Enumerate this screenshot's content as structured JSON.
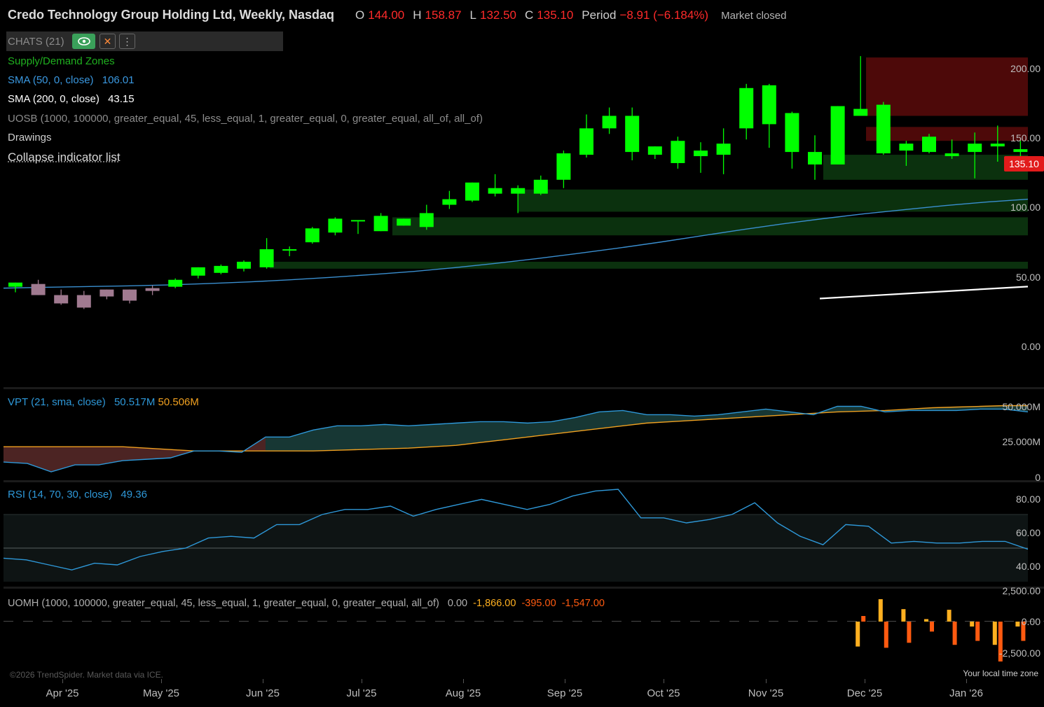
{
  "header": {
    "title": "Credo Technology Group Holding Ltd, Weekly, Nasdaq",
    "o_label": "O",
    "o": "144.00",
    "h_label": "H",
    "h": "158.87",
    "l_label": "L",
    "l": "132.50",
    "c_label": "C",
    "c": "135.10",
    "period_label": "Period",
    "period": "−8.91 (−6.184%)",
    "market_status": "Market closed"
  },
  "indicators": {
    "chats": "CHATS (21)",
    "supply_demand": "Supply/Demand Zones",
    "sma50_label": "SMA (50, 0, close)",
    "sma50_value": "106.01",
    "sma200_label": "SMA (200, 0, close)",
    "sma200_value": "43.15",
    "uosb": "UOSB (1000, 100000, greater_equal, 45, less_equal, 1, greater_equal, 0, greater_equal, all_of, all_of)",
    "drawings": "Drawings",
    "collapse": "Collapse indicator list",
    "vpt_label": "VPT (21, sma, close)",
    "vpt_value1": "50.517M",
    "vpt_value2": "50.506M",
    "rsi_label": "RSI (14, 70, 30, close)",
    "rsi_value": "49.36",
    "uomh_label": "UOMH (1000, 100000, greater_equal, 45, less_equal, 1, greater_equal, 0, greater_equal, all_of)",
    "uomh_v1": "0.00",
    "uomh_v2": "-1,866.00",
    "uomh_v3": "-395.00",
    "uomh_v4": "-1,547.00"
  },
  "price_tag": "135.10",
  "footer": {
    "copyright": "©2026 TrendSpider. Market data via ICE.",
    "timezone": "Your local time zone"
  },
  "colors": {
    "up": "#00ff00",
    "down_early": "#a07a90",
    "sma50": "#3a8fd0",
    "sma200": "#ffffff",
    "vpt": "#2e98d8",
    "vpt_signal": "#f0a020",
    "rsi": "#2e98d8",
    "zone_demand": "#0d3a10",
    "zone_supply": "#5a0a0a",
    "uomh_a": "#ffb020",
    "uomh_b": "#ff5a10",
    "price_tag": "#e21b1b"
  },
  "chart_data": [
    {
      "type": "candlestick",
      "title": "Credo Technology Group Holding Ltd, Weekly, Nasdaq",
      "x_labels": [
        "Apr '25",
        "May '25",
        "Jun '25",
        "Jul '25",
        "Aug '25",
        "Sep '25",
        "Oct '25",
        "Nov '25",
        "Dec '25",
        "Jan '26"
      ],
      "y_ticks": [
        "200.00",
        "150.00",
        "100.00",
        "50.00",
        "0.00"
      ],
      "ylim": [
        0,
        200
      ],
      "candles": [
        {
          "o": 43,
          "h": 46,
          "l": 39,
          "c": 46
        },
        {
          "o": 45,
          "h": 48,
          "l": 37,
          "c": 37
        },
        {
          "o": 37,
          "h": 41,
          "l": 30,
          "c": 31
        },
        {
          "o": 37,
          "h": 40,
          "l": 27,
          "c": 28
        },
        {
          "o": 41,
          "h": 41,
          "l": 34,
          "c": 36
        },
        {
          "o": 41,
          "h": 41,
          "l": 31,
          "c": 33
        },
        {
          "o": 42,
          "h": 44,
          "l": 37,
          "c": 40
        },
        {
          "o": 43,
          "h": 49,
          "l": 42,
          "c": 48
        },
        {
          "o": 51,
          "h": 57,
          "l": 49,
          "c": 57
        },
        {
          "o": 53,
          "h": 59,
          "l": 52,
          "c": 58
        },
        {
          "o": 56,
          "h": 62,
          "l": 54,
          "c": 61
        },
        {
          "o": 57,
          "h": 78,
          "l": 56,
          "c": 70
        },
        {
          "o": 70,
          "h": 72,
          "l": 65,
          "c": 70
        },
        {
          "o": 75,
          "h": 86,
          "l": 74,
          "c": 85
        },
        {
          "o": 82,
          "h": 93,
          "l": 80,
          "c": 92
        },
        {
          "o": 90,
          "h": 90,
          "l": 81,
          "c": 91
        },
        {
          "o": 83,
          "h": 96,
          "l": 83,
          "c": 94
        },
        {
          "o": 87,
          "h": 92,
          "l": 87,
          "c": 92
        },
        {
          "o": 86,
          "h": 102,
          "l": 84,
          "c": 96
        },
        {
          "o": 102,
          "h": 112,
          "l": 99,
          "c": 106
        },
        {
          "o": 105,
          "h": 118,
          "l": 104,
          "c": 118
        },
        {
          "o": 110,
          "h": 124,
          "l": 108,
          "c": 114
        },
        {
          "o": 110,
          "h": 116,
          "l": 96,
          "c": 114
        },
        {
          "o": 110,
          "h": 123,
          "l": 109,
          "c": 120
        },
        {
          "o": 120,
          "h": 141,
          "l": 114,
          "c": 139
        },
        {
          "o": 138,
          "h": 167,
          "l": 136,
          "c": 157
        },
        {
          "o": 157,
          "h": 172,
          "l": 153,
          "c": 166
        },
        {
          "o": 140,
          "h": 172,
          "l": 134,
          "c": 166
        },
        {
          "o": 138,
          "h": 144,
          "l": 135,
          "c": 144
        },
        {
          "o": 132,
          "h": 151,
          "l": 128,
          "c": 148
        },
        {
          "o": 137,
          "h": 147,
          "l": 125,
          "c": 141
        },
        {
          "o": 138,
          "h": 157,
          "l": 124,
          "c": 146
        },
        {
          "o": 157,
          "h": 189,
          "l": 149,
          "c": 186
        },
        {
          "o": 160,
          "h": 189,
          "l": 143,
          "c": 188
        },
        {
          "o": 140,
          "h": 169,
          "l": 128,
          "c": 168
        },
        {
          "o": 131,
          "h": 152,
          "l": 120,
          "c": 140
        },
        {
          "o": 131,
          "h": 173,
          "l": 131,
          "c": 173
        },
        {
          "o": 166,
          "h": 209,
          "l": 166,
          "c": 171
        },
        {
          "o": 139,
          "h": 176,
          "l": 138,
          "c": 174
        },
        {
          "o": 141,
          "h": 148,
          "l": 130,
          "c": 146
        },
        {
          "o": 140,
          "h": 153,
          "l": 139,
          "c": 151
        },
        {
          "o": 137,
          "h": 149,
          "l": 135,
          "c": 139
        },
        {
          "o": 140,
          "h": 154,
          "l": 121,
          "c": 146
        },
        {
          "o": 144,
          "h": 159,
          "l": 133,
          "c": 146
        },
        {
          "o": 140,
          "h": 148,
          "l": 132,
          "c": 142
        }
      ],
      "sma50": [
        42,
        42.6,
        43.1,
        43.6,
        44.3,
        45.3,
        46.5,
        48,
        49.8,
        51.8,
        54,
        56.7,
        59.8,
        63.2,
        66.9,
        70.8,
        75,
        79.5,
        84,
        88.2,
        92,
        95.5,
        98.5,
        101.5,
        104,
        106.01
      ],
      "sma200": [
        34.5,
        43.15
      ],
      "zones": [
        {
          "kind": "supply",
          "from": 166,
          "to": 208
        },
        {
          "kind": "supply",
          "from": 148,
          "to": 158
        },
        {
          "kind": "demand",
          "from": 120,
          "to": 138
        },
        {
          "kind": "demand",
          "from": 97,
          "to": 113
        },
        {
          "kind": "demand",
          "from": 80,
          "to": 93
        },
        {
          "kind": "demand",
          "from": 56,
          "to": 61
        }
      ]
    },
    {
      "type": "area",
      "title": "VPT (21, sma, close)",
      "y_ticks": [
        "50.000M",
        "25.000M",
        "0"
      ],
      "ylim": [
        0,
        55
      ],
      "series": [
        {
          "name": "VPT",
          "values": [
            10,
            9,
            3,
            8,
            8,
            11,
            12,
            13,
            18,
            18,
            17,
            28,
            28,
            33,
            36,
            36,
            37,
            36,
            37,
            38,
            39,
            39,
            38,
            39,
            42,
            46,
            47,
            44,
            44,
            43,
            44,
            46,
            48,
            46,
            44,
            50,
            50,
            46,
            47,
            47,
            47,
            48,
            48,
            46
          ]
        },
        {
          "name": "Signal",
          "values": [
            21,
            21,
            21,
            21,
            21,
            21,
            20,
            19,
            18,
            18,
            18,
            18,
            18,
            18,
            18.5,
            19,
            19.5,
            20,
            21,
            22,
            24,
            26,
            28,
            30,
            32,
            34,
            36,
            38,
            39,
            40,
            41,
            42,
            43,
            44,
            45,
            46,
            46.5,
            47,
            48,
            49,
            49.5,
            50,
            50.5,
            50.5
          ]
        }
      ]
    },
    {
      "type": "line",
      "title": "RSI (14, 70, 30, close)",
      "y_ticks": [
        "80.00",
        "60.00",
        "40.00"
      ],
      "ylim": [
        30,
        85
      ],
      "series": [
        {
          "name": "RSI",
          "values": [
            44,
            43,
            40,
            37,
            41,
            40,
            45,
            48,
            50,
            56,
            57,
            56,
            64,
            64,
            70,
            73,
            73,
            75,
            69,
            73,
            76,
            79,
            76,
            73,
            76,
            81,
            84,
            85,
            68,
            68,
            65,
            67,
            70,
            77,
            65,
            57,
            52,
            64,
            63,
            53,
            54,
            53,
            53,
            54,
            54,
            49.36
          ]
        }
      ]
    },
    {
      "type": "bar",
      "title": "UOMH (1000, 100000, greater_equal, 45, less_equal, 1, greater_equal, 0, greater_equal, all_of)",
      "y_ticks": [
        "2,500.00",
        "0.00",
        "-2,500.00"
      ],
      "ylim": [
        -3500,
        2600
      ],
      "values": [
        {
          "i": 37,
          "a": -2000,
          "b": 450
        },
        {
          "i": 38,
          "a": 1800,
          "b": -2100
        },
        {
          "i": 39,
          "a": 1000,
          "b": -1700
        },
        {
          "i": 40,
          "a": 200,
          "b": -800
        },
        {
          "i": 41,
          "a": 950,
          "b": -1866
        },
        {
          "i": 42,
          "a": -395,
          "b": -1547
        },
        {
          "i": 43,
          "a": -1866,
          "b": -3200
        },
        {
          "i": 44,
          "a": -395,
          "b": -1547
        }
      ]
    }
  ]
}
